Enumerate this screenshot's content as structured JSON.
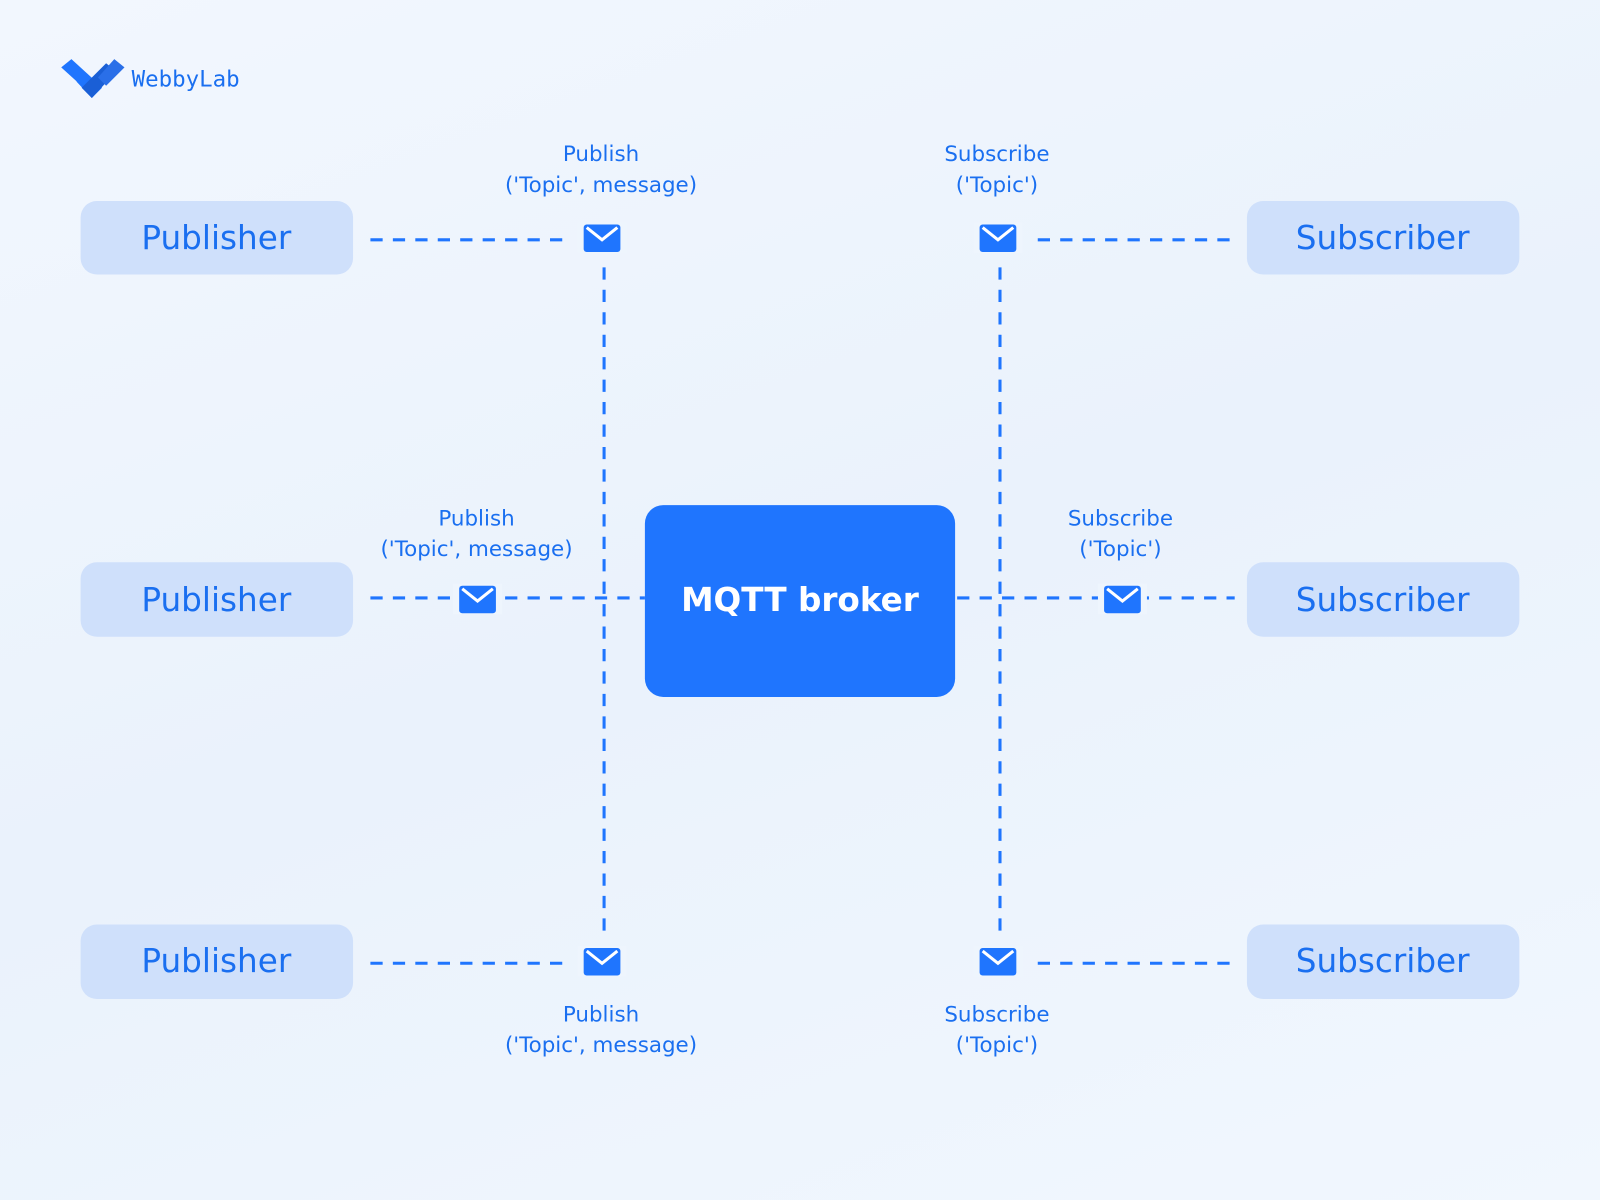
{
  "logo": {
    "text": "WebbyLab"
  },
  "broker": {
    "label": "MQTT broker"
  },
  "publishers": [
    {
      "label": "Publisher"
    },
    {
      "label": "Publisher"
    },
    {
      "label": "Publisher"
    }
  ],
  "subscribers": [
    {
      "label": "Subscriber"
    },
    {
      "label": "Subscriber"
    },
    {
      "label": "Subscriber"
    }
  ],
  "publish_labels": [
    {
      "line1": "Publish",
      "line2": "('Topic', message)"
    },
    {
      "line1": "Publish",
      "line2": "('Topic', message)"
    },
    {
      "line1": "Publish",
      "line2": "('Topic', message)"
    }
  ],
  "subscribe_labels": [
    {
      "line1": "Subscribe",
      "line2": "('Topic')"
    },
    {
      "line1": "Subscribe",
      "line2": "('Topic')"
    },
    {
      "line1": "Subscribe",
      "line2": "('Topic')"
    }
  ],
  "icons": {
    "message": "envelope-icon"
  },
  "colors": {
    "accent": "#1f75fe",
    "node_fill": "#cfe0fb",
    "text": "#1a6ff0",
    "background": "#eef5fd"
  }
}
